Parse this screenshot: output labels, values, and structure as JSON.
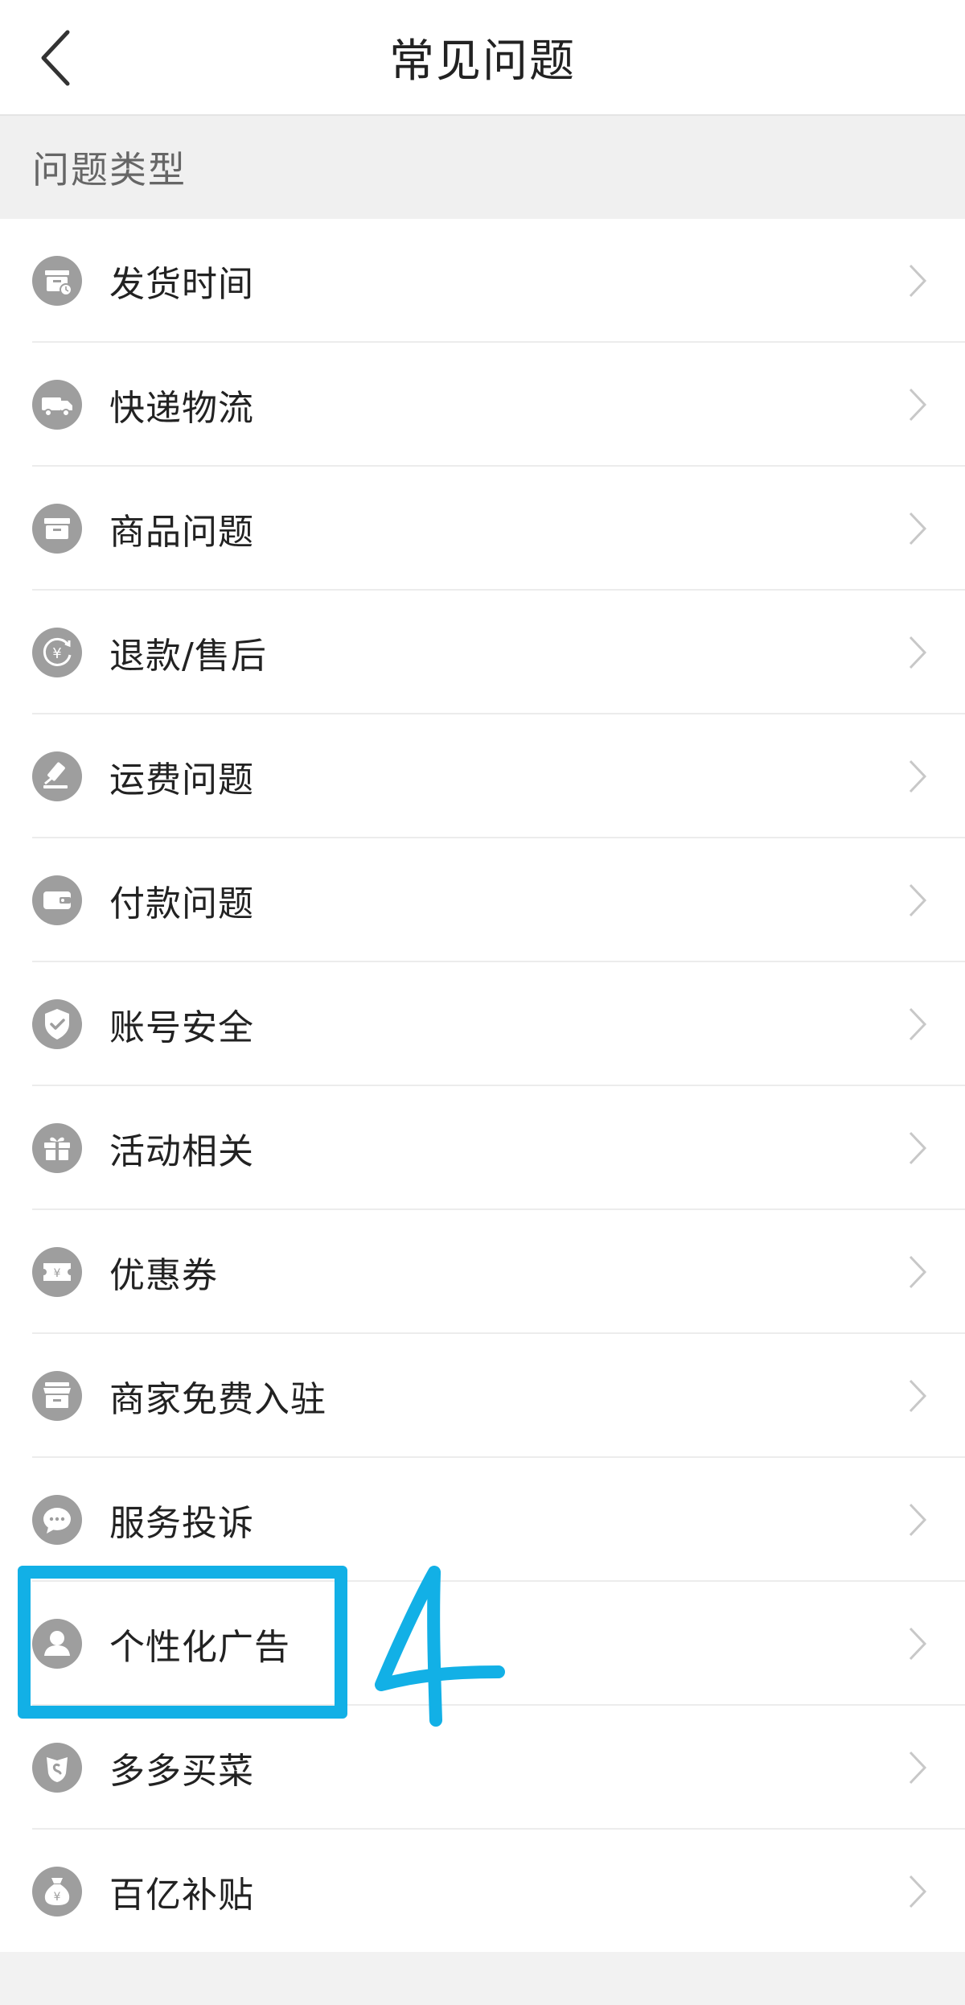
{
  "header": {
    "title": "常见问题"
  },
  "section": {
    "title": "问题类型"
  },
  "items": [
    {
      "label": "发货时间",
      "icon": "shipping-time-icon"
    },
    {
      "label": "快递物流",
      "icon": "delivery-truck-icon"
    },
    {
      "label": "商品问题",
      "icon": "product-box-icon"
    },
    {
      "label": "退款/售后",
      "icon": "refund-yuan-icon"
    },
    {
      "label": "运费问题",
      "icon": "shipping-fee-icon"
    },
    {
      "label": "付款问题",
      "icon": "wallet-icon"
    },
    {
      "label": "账号安全",
      "icon": "shield-check-icon"
    },
    {
      "label": "活动相关",
      "icon": "gift-icon"
    },
    {
      "label": "优惠券",
      "icon": "coupon-icon"
    },
    {
      "label": "商家免费入驻",
      "icon": "storefront-icon"
    },
    {
      "label": "服务投诉",
      "icon": "chat-bubble-icon"
    },
    {
      "label": "个性化广告",
      "icon": "person-icon"
    },
    {
      "label": "多多买菜",
      "icon": "vegetable-icon"
    },
    {
      "label": "百亿补贴",
      "icon": "money-bag-icon"
    }
  ],
  "annotation": {
    "number": "4",
    "color": "#12b0e6"
  },
  "colors": {
    "icon_bg": "#9e9e9e",
    "text": "#222222",
    "chevron": "#c8c8c8"
  }
}
